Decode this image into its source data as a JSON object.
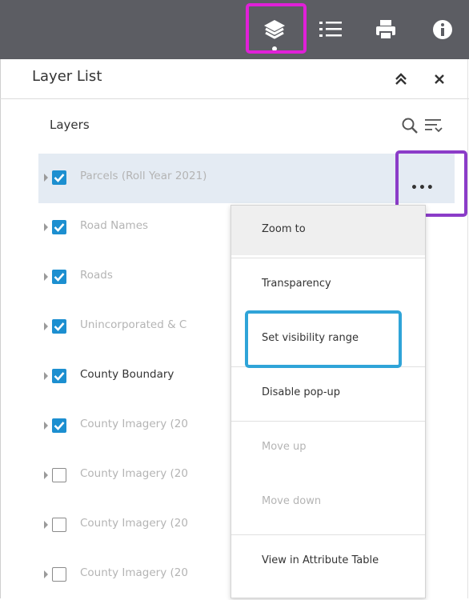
{
  "toolbar": {
    "buttons": [
      {
        "name": "layers",
        "icon": "layers-icon",
        "active": true
      },
      {
        "name": "legend",
        "icon": "list-icon"
      },
      {
        "name": "print",
        "icon": "print-icon"
      },
      {
        "name": "about",
        "icon": "info-icon"
      }
    ]
  },
  "panel": {
    "title": "Layer List",
    "collapse_icon": "double-chevron-up-icon",
    "close_icon": "close-icon"
  },
  "layers_header": {
    "label": "Layers",
    "search_icon": "search-icon",
    "filter_icon": "filter-icon"
  },
  "layers": [
    {
      "name": "Parcels (Roll Year 2021)",
      "checked": true,
      "selected": true,
      "dim": true
    },
    {
      "name": "Road Names",
      "checked": true,
      "dim": true
    },
    {
      "name": "Roads",
      "checked": true,
      "dim": true
    },
    {
      "name": "Unincorporated & C",
      "checked": true,
      "dim": true
    },
    {
      "name": "County Boundary",
      "checked": true,
      "dim": false
    },
    {
      "name": "County Imagery (20",
      "checked": true,
      "dim": true
    },
    {
      "name": "County Imagery (20",
      "checked": false,
      "dim": true
    },
    {
      "name": "County Imagery (20",
      "checked": false,
      "dim": true
    },
    {
      "name": "County Imagery (20",
      "checked": false,
      "dim": true
    }
  ],
  "more_button": {
    "label": "•••"
  },
  "context_menu": {
    "items": [
      {
        "label": "Zoom to",
        "enabled": true,
        "hover": true
      },
      {
        "label": "Transparency",
        "enabled": true
      },
      {
        "label": "Set visibility range",
        "enabled": true
      },
      {
        "label": "Disable pop-up",
        "enabled": true
      },
      {
        "label": "Move up",
        "enabled": false
      },
      {
        "label": "Move down",
        "enabled": false
      },
      {
        "label": "View in Attribute Table",
        "enabled": true
      }
    ]
  },
  "colors": {
    "toolbar_bg": "#5c5d63",
    "checkbox_checked": "#1c8fd0",
    "selected_row": "#e4ebf3",
    "highlight_magenta": "#e020d8",
    "highlight_purple": "#8b3cc8",
    "highlight_blue": "#2fa4d8"
  }
}
